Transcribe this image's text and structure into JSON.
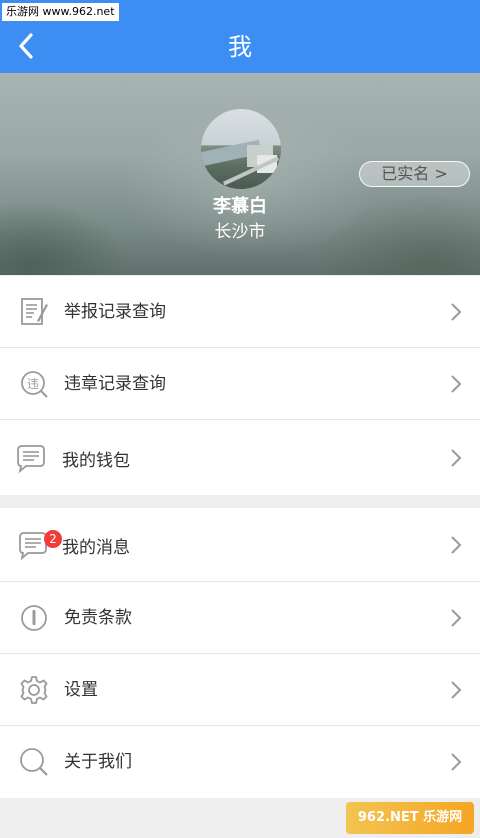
{
  "status_bar": {
    "watermark": "乐游网 www.962.net"
  },
  "nav": {
    "title": "我",
    "back_icon": "chevron-left-icon"
  },
  "profile": {
    "name": "李慕白",
    "city": "长沙市",
    "verify_label": "已实名 >"
  },
  "menu_group1": [
    {
      "label": "举报记录查询",
      "icon": "report-document-icon"
    },
    {
      "label": "违章记录查询",
      "icon": "violation-search-icon"
    },
    {
      "label": "我的钱包",
      "icon": "wallet-chat-icon"
    }
  ],
  "menu_group2": [
    {
      "label": "我的消息",
      "icon": "message-icon",
      "badge": "2"
    },
    {
      "label": "免责条款",
      "icon": "info-icon"
    },
    {
      "label": "设置",
      "icon": "gear-icon"
    },
    {
      "label": "关于我们",
      "icon": "search-icon"
    }
  ],
  "footer": {
    "watermark": "962.NET 乐游网"
  },
  "colors": {
    "accent": "#3c8ef3",
    "badge": "#f23c3c"
  }
}
